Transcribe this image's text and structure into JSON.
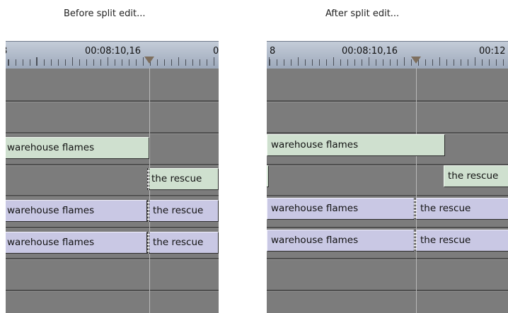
{
  "captions": {
    "before": "Before split edit...",
    "after": "After split edit..."
  },
  "before": {
    "ruler": {
      "left_label": "8",
      "center_label": "00:08:10,16",
      "right_label": "0"
    },
    "clips": {
      "video_top": "warehouse flames",
      "video_bottom_right": "the rescue",
      "audio1_left": "warehouse flames",
      "audio1_right": "the rescue",
      "audio2_left": "warehouse flames",
      "audio2_right": "the rescue"
    }
  },
  "after": {
    "ruler": {
      "left_label": "8",
      "center_label": "00:08:10,16",
      "right_label": "00:12"
    },
    "clips": {
      "video_top": "warehouse flames",
      "video_bottom_right": "the rescue",
      "audio1_left": "warehouse flames",
      "audio1_right": "the rescue",
      "audio2_left": "warehouse flames",
      "audio2_right": "the rescue"
    }
  },
  "colors": {
    "track_bg": "#7c7c7c",
    "video_clip": "#cfe0cf",
    "audio_clip": "#c9c8e4",
    "ruler": "#a9b4c4"
  }
}
